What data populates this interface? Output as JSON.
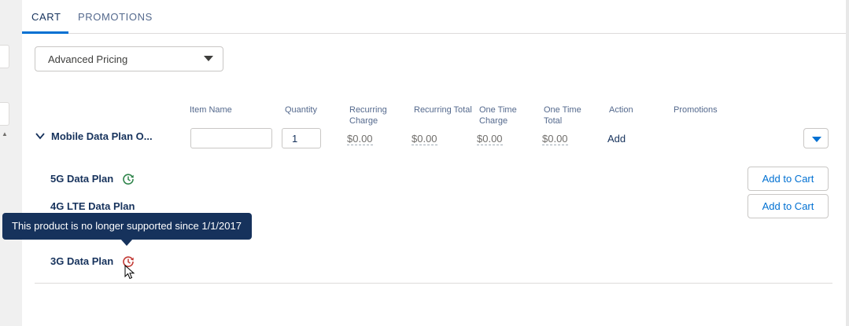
{
  "tabs": [
    {
      "label": "CART",
      "active": true
    },
    {
      "label": "PROMOTIONS",
      "active": false
    }
  ],
  "pricing_select": {
    "value": "Advanced Pricing"
  },
  "columns": {
    "item_name": "Item Name",
    "quantity": "Quantity",
    "recurring_charge_1": "Recurring",
    "recurring_charge_2": "Charge",
    "recurring_total": "Recurring Total",
    "one_time_charge_1": "One Time",
    "one_time_charge_2": "Charge",
    "one_time_total_1": "One Time",
    "one_time_total_2": "Total",
    "action": "Action",
    "promotions": "Promotions"
  },
  "row": {
    "name": "Mobile Data Plan O...",
    "item_name_value": "",
    "quantity_value": "1",
    "recurring_charge": "$0.00",
    "recurring_total": "$0.00",
    "one_time_charge": "$0.00",
    "one_time_total": "$0.00",
    "action": "Add"
  },
  "products": [
    {
      "name": "5G Data Plan",
      "status": "supported",
      "status_color": "#2e844a",
      "add_label": "Add to Cart"
    },
    {
      "name": "4G LTE Data Plan",
      "status": "none",
      "add_label": "Add to Cart"
    },
    {
      "name": "3G Data Plan",
      "status": "unsupported",
      "status_color": "#c23934"
    }
  ],
  "tooltip": {
    "text": "This product is no longer supported since 1/1/2017"
  },
  "colors": {
    "accent": "#0070d2",
    "text": "#16325c",
    "tooltip_bg": "#16325c"
  }
}
